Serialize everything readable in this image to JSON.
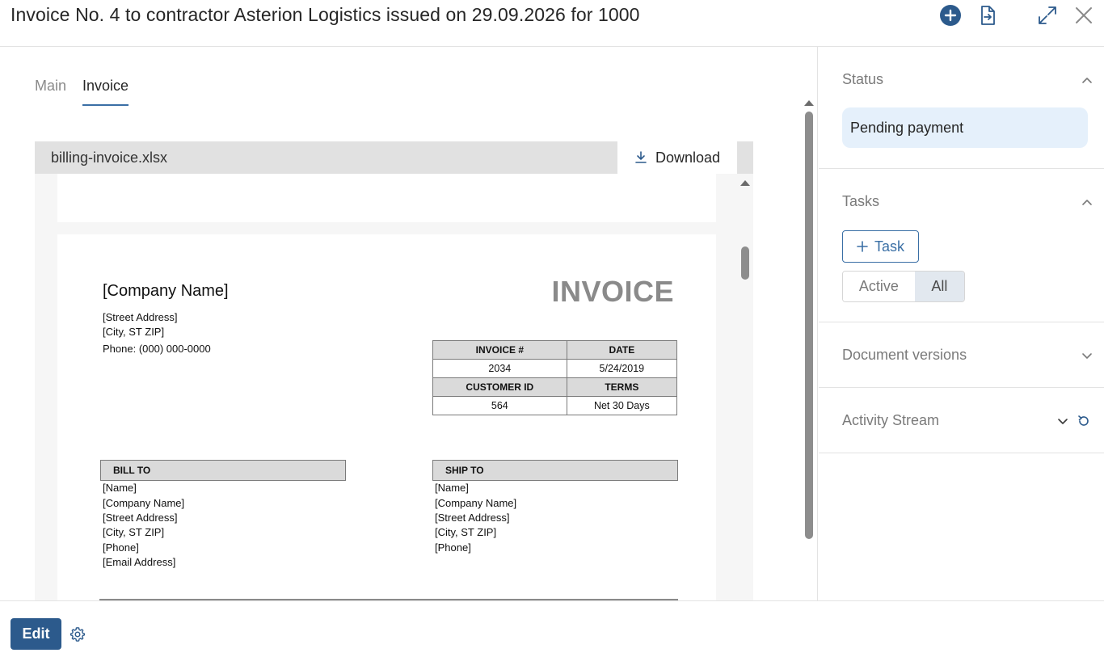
{
  "header": {
    "title": "Invoice No. 4 to contractor Asterion Logistics issued on 29.09.2026 for 1000",
    "actions": [
      "add-icon",
      "export-icon",
      "expand-icon",
      "close-icon"
    ]
  },
  "tabs": [
    {
      "label": "Main",
      "active": false
    },
    {
      "label": "Invoice",
      "active": true
    }
  ],
  "file": {
    "name": "billing-invoice.xlsx",
    "download_label": "Download"
  },
  "invoice": {
    "company_name": "[Company Name]",
    "street": "[Street Address]",
    "city": "[City, ST  ZIP]",
    "phone": "Phone: (000) 000-0000",
    "heading": "INVOICE",
    "meta_headers": [
      "INVOICE #",
      "DATE",
      "CUSTOMER ID",
      "TERMS"
    ],
    "invoice_number": "2034",
    "date": "5/24/2019",
    "customer_id": "564",
    "terms": "Net 30 Days",
    "bill_to": {
      "label": "BILL TO",
      "lines": [
        "[Name]",
        "[Company Name]",
        "[Street Address]",
        "[City, ST  ZIP]",
        "[Phone]",
        "[Email Address]"
      ]
    },
    "ship_to": {
      "label": "SHIP TO",
      "lines": [
        "[Name]",
        "[Company Name]",
        "[Street Address]",
        "[City, ST  ZIP]",
        "[Phone]"
      ]
    }
  },
  "side": {
    "status": {
      "title": "Status",
      "value": "Pending payment"
    },
    "tasks": {
      "title": "Tasks",
      "add_label": "Task",
      "filter_active": "Active",
      "filter_all": "All",
      "selected_filter": "All"
    },
    "document_versions": {
      "title": "Document versions"
    },
    "activity_stream": {
      "title": "Activity Stream"
    }
  },
  "footer": {
    "edit_label": "Edit"
  },
  "colors": {
    "accent": "#2c5a8c",
    "accent_outline": "#3a6fa5",
    "status_bg": "#e5f0fb"
  }
}
